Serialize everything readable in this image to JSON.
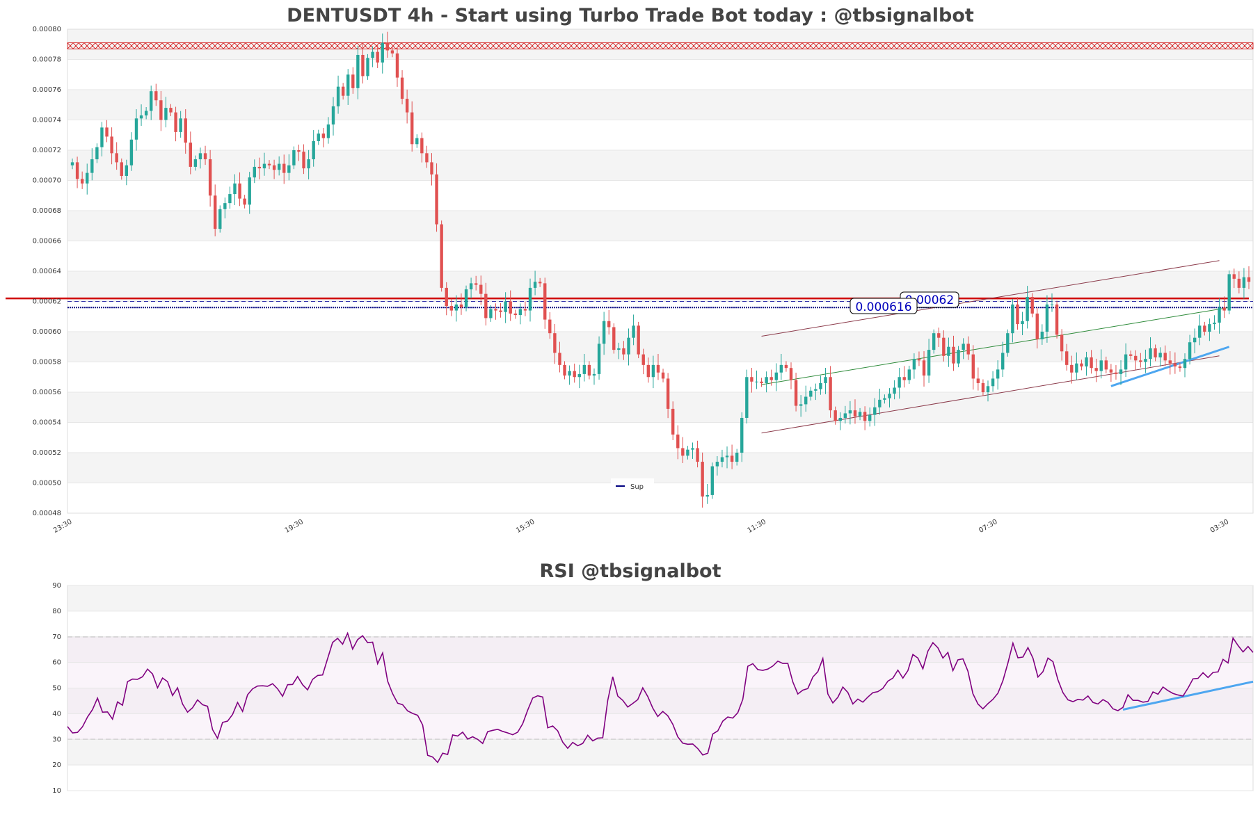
{
  "chart_data": [
    {
      "type": "candlestick",
      "title": "DENTUSDT 4h - Start using Turbo Trade Bot today : @tbsignalbot",
      "ylim": [
        0.00048,
        0.0008
      ],
      "yticks": [
        "0.00048",
        "0.00050",
        "0.00052",
        "0.00054",
        "0.00056",
        "0.00058",
        "0.00060",
        "0.00062",
        "0.00064",
        "0.00066",
        "0.00068",
        "0.00070",
        "0.00072",
        "0.00074",
        "0.00076",
        "0.00078",
        "0.00080"
      ],
      "xticks": [
        {
          "label": "23:30",
          "index": 0
        },
        {
          "label": "19:30",
          "index": 47
        },
        {
          "label": "15:30",
          "index": 94
        },
        {
          "label": "11:30",
          "index": 141
        },
        {
          "label": "07:30",
          "index": 188
        },
        {
          "label": "03:30",
          "index": 235
        }
      ],
      "closes": [
        0.000712,
        0.000701,
        0.000698,
        0.000705,
        0.000714,
        0.000722,
        0.000735,
        0.000729,
        0.000718,
        0.000712,
        0.000703,
        0.00071,
        0.000727,
        0.000741,
        0.000743,
        0.000746,
        0.000759,
        0.000753,
        0.00074,
        0.000748,
        0.000745,
        0.000732,
        0.000741,
        0.000725,
        0.000709,
        0.000714,
        0.000718,
        0.000714,
        0.00069,
        0.000668,
        0.000681,
        0.000685,
        0.000691,
        0.000698,
        0.000688,
        0.000684,
        0.000702,
        0.000709,
        0.000708,
        0.000711,
        0.00071,
        0.000707,
        0.000711,
        0.000705,
        0.00071,
        0.00072,
        0.000719,
        0.000708,
        0.000714,
        0.000726,
        0.000731,
        0.000728,
        0.000737,
        0.000749,
        0.000762,
        0.000756,
        0.00077,
        0.000761,
        0.000783,
        0.000769,
        0.000781,
        0.000785,
        0.000778,
        0.000791,
        0.000786,
        0.000784,
        0.000768,
        0.000754,
        0.000745,
        0.000724,
        0.000728,
        0.000718,
        0.000712,
        0.000704,
        0.000671,
        0.000629,
        0.000617,
        0.000614,
        0.000618,
        0.000616,
        0.000628,
        0.000632,
        0.000631,
        0.000625,
        0.000609,
        0.000615,
        0.000614,
        0.000613,
        0.00062,
        0.000612,
        0.000611,
        0.000615,
        0.000614,
        0.000629,
        0.000633,
        0.000632,
        0.000608,
        0.000599,
        0.000586,
        0.000578,
        0.000571,
        0.000574,
        0.00057,
        0.000572,
        0.000578,
        0.000571,
        0.000572,
        0.000592,
        0.000607,
        0.000603,
        0.000588,
        0.000589,
        0.000585,
        0.000596,
        0.000604,
        0.000585,
        0.000578,
        0.00057,
        0.000578,
        0.000573,
        0.000569,
        0.000549,
        0.000532,
        0.000523,
        0.000518,
        0.000522,
        0.000523,
        0.000514,
        0.000491,
        0.000492,
        0.000511,
        0.000514,
        0.000517,
        0.000518,
        0.000514,
        0.00052,
        0.000543,
        0.00057,
        0.000567,
        0.000567,
        0.000566,
        0.00057,
        0.000568,
        0.000573,
        0.000578,
        0.000576,
        0.000568,
        0.000551,
        0.000552,
        0.000557,
        0.000561,
        0.000562,
        0.000566,
        0.00057,
        0.000548,
        0.000541,
        0.000543,
        0.000546,
        0.000548,
        0.000544,
        0.000547,
        0.000541,
        0.000545,
        0.00055,
        0.000555,
        0.000556,
        0.000559,
        0.000563,
        0.00057,
        0.000568,
        0.000575,
        0.000582,
        0.000581,
        0.000571,
        0.000588,
        0.000599,
        0.000596,
        0.000584,
        0.00059,
        0.000579,
        0.000588,
        0.000592,
        0.000585,
        0.000569,
        0.000566,
        0.00056,
        0.000564,
        0.000569,
        0.000575,
        0.000586,
        0.000599,
        0.000618,
        0.000605,
        0.000607,
        0.000623,
        0.000612,
        0.000595,
        0.0006,
        0.000618,
        0.000618,
        0.000598,
        0.000587,
        0.000578,
        0.000573,
        0.000579,
        0.000577,
        0.000583,
        0.000576,
        0.000574,
        0.000581,
        0.000575,
        0.000573,
        0.000572,
        0.000575,
        0.000585,
        0.000584,
        0.000581,
        0.00058,
        0.000582,
        0.000589,
        0.000583,
        0.000586,
        0.000581,
        0.000579,
        0.000577,
        0.000576,
        0.000582,
        0.000593,
        0.000596,
        0.000604,
        0.0006,
        0.000605,
        0.000606,
        0.000616,
        0.000614,
        0.000638,
        0.000635,
        0.000629,
        0.000636,
        0.000633
      ]
    },
    {
      "type": "line",
      "title": "RSI @tbsignalbot",
      "ylim": [
        10,
        90
      ],
      "yticks": [
        "10",
        "20",
        "30",
        "40",
        "50",
        "60",
        "70",
        "80",
        "90"
      ],
      "values": [
        35,
        32.5,
        32.7,
        34.9,
        38.7,
        41.6,
        46.1,
        40.6,
        40.7,
        37.9,
        44.6,
        43.3,
        52.5,
        53.5,
        53.4,
        54.4,
        57.4,
        55.5,
        50.1,
        53.9,
        52.5,
        47.1,
        50.1,
        43.8,
        40.6,
        42.3,
        45.4,
        43.5,
        42.9,
        33.8,
        30.4,
        36.6,
        37.1,
        39.7,
        44.4,
        40.9,
        47.4,
        49.7,
        50.8,
        50.9,
        50.7,
        51.7,
        49.7,
        46.8,
        51.3,
        51.4,
        54.5,
        51.3,
        49.3,
        53.4,
        54.9,
        55.1,
        61.5,
        67.8,
        69.4,
        67.1,
        71.4,
        65.2,
        68.9,
        70.4,
        67.7,
        67.9,
        59.5,
        63.7,
        52.7,
        47.8,
        44.1,
        43.5,
        41.1,
        40.1,
        39.4,
        35.6,
        23.8,
        23.1,
        21,
        24.6,
        24.1,
        31.7,
        31.3,
        32.8,
        30.1,
        31,
        30,
        28.4,
        33,
        33.5,
        33.9,
        33.1,
        32.5,
        31.8,
        32.8,
        36.1,
        41.4,
        46.1,
        47,
        46.5,
        34.5,
        35.2,
        33.3,
        28.9,
        26.5,
        28.8,
        27.5,
        28.4,
        31.6,
        29.4,
        30.5,
        30.6,
        45.2,
        54.4,
        46.9,
        45.2,
        42.6,
        44,
        45.5,
        50.1,
        46.7,
        42.2,
        38.9,
        40.9,
        39.2,
        35.9,
        31,
        28.5,
        28.1,
        28.2,
        26.4,
        23.9,
        24.6,
        32.1,
        33.3,
        37.1,
        38.7,
        38.3,
        40.4,
        45.6,
        58.5,
        59.5,
        57.2,
        56.9,
        57.4,
        58.6,
        60.5,
        59.6,
        59.6,
        52.4,
        47.7,
        49.2,
        49.8,
        54.3,
        56.4,
        61.5,
        47.7,
        44.2,
        46.4,
        50.4,
        48.3,
        43.8,
        45.7,
        44.5,
        46.5,
        48.2,
        48.6,
        49.9,
        52.7,
        53.9,
        57,
        53.9,
        56.8,
        63.1,
        61.7,
        57.5,
        64.4,
        67.7,
        65.7,
        61.7,
        63.9,
        56.8,
        61,
        61.4,
        56.6,
        47.8,
        43.8,
        41.9,
        43.9,
        45.6,
        48,
        52.9,
        59.8,
        67.5,
        61.8,
        62.1,
        65.8,
        61.7,
        54.3,
        56.4,
        61.7,
        60.3,
        53.2,
        48.2,
        45.4,
        44.7,
        45.6,
        45.3,
        46.9,
        44.4,
        43.8,
        45.5,
        44.4,
        41.9,
        41.2,
        42.5,
        47.4,
        45.2,
        45.2,
        44.5,
        44.8,
        48.5,
        47.6,
        50.4,
        49,
        47.9,
        47.3,
        46.9,
        50,
        53.6,
        53.8,
        56,
        54.1,
        56.1,
        56.3,
        61.2,
        59.8,
        69.5,
        66.6,
        64.1,
        66.2,
        63.9
      ]
    }
  ],
  "annotations": {
    "label_0062": "0.00062",
    "label_000616": "0.000616",
    "legend_sup": "Sup"
  },
  "colors": {
    "up": "#26a69a",
    "down": "#e05050",
    "rsi": "#800080",
    "trend_blue": "#4da6f0",
    "resistance": "#d00000",
    "support": "#000080",
    "channel": "#8b3a4a",
    "channel_mid": "#2e8b3a"
  }
}
